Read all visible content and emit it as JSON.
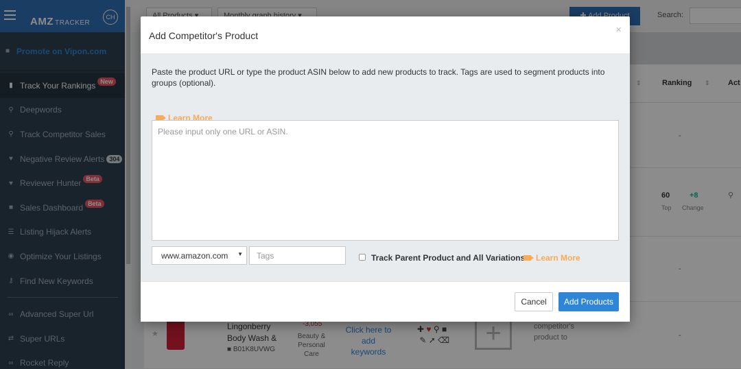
{
  "app": {
    "logo_main": "AMZ",
    "logo_sub": "TRACKER",
    "user_initials": "CH"
  },
  "sidebar": {
    "promote": "Promote on Vipon.com",
    "items": [
      {
        "label": "Track Your Rankings",
        "badge": "New",
        "icon": "bar-chart-icon"
      },
      {
        "label": "Deepwords",
        "badge": "",
        "icon": "search-icon"
      },
      {
        "label": "Track Competitor Sales",
        "badge": "",
        "icon": "search-icon"
      },
      {
        "label": "Negative Review Alerts",
        "badge": "304",
        "icon": "heart-icon"
      },
      {
        "label": "Reviewer Hunter",
        "badge": "Beta",
        "icon": "heart-icon"
      },
      {
        "label": "Sales Dashboard",
        "badge": "Beta",
        "icon": "gift-icon"
      },
      {
        "label": "Listing Hijack Alerts",
        "badge": "",
        "icon": "list-icon"
      },
      {
        "label": "Optimize Your Listings",
        "badge": "",
        "icon": "eye-icon"
      },
      {
        "label": "Find New Keywords",
        "badge": "",
        "icon": "key-icon"
      },
      {
        "label": "Advanced Super Url",
        "badge": "",
        "icon": "link-icon"
      },
      {
        "label": "Super URLs",
        "badge": "",
        "icon": "shuffle-icon"
      },
      {
        "label": "Rocket Reply",
        "badge": "",
        "icon": "link-icon"
      }
    ]
  },
  "background": {
    "filter_products": "All Products",
    "filter_graph": "Monthly graph history",
    "add_product": "Add Product",
    "search_label": "Search:",
    "col_ranking": "Ranking",
    "col_actions": "Act",
    "dash": "-",
    "rank_value": "60",
    "rank_change": "+8",
    "rank_top_label": "Top",
    "rank_change_label": "Change",
    "product_name_1": "Lingonberry",
    "product_name_2": "Body Wash &",
    "product_asin": "B01K8UVWG",
    "product_price": "-3,055",
    "category_1": "Beauty &",
    "category_2": "Personal",
    "category_3": "Care",
    "keywords_1": "Click here to",
    "keywords_2": "add keywords",
    "competitor_1": "competitor's",
    "competitor_2": "product to"
  },
  "modal": {
    "title": "Add Competitor's Product",
    "close": "×",
    "intro": "Paste the product URL or type the product ASIN below to add new products to track. Tags are used to segment products into groups (optional).",
    "learn_more": "Learn More",
    "url_placeholder": "Please input only one URL or ASIN.",
    "domain_value": "www.amazon.com",
    "tags_placeholder": "Tags",
    "checkbox_label": "Track Parent Product and All Variations",
    "learn_more_2": "Learn More",
    "cancel": "Cancel",
    "add": "Add Products"
  },
  "colors": {
    "sidebar_bg": "#2f4050",
    "brand_blue": "#2f6fb5",
    "link_blue": "#2f86d6",
    "learn_orange": "#f8ac59",
    "badge_red": "#ed5565"
  }
}
